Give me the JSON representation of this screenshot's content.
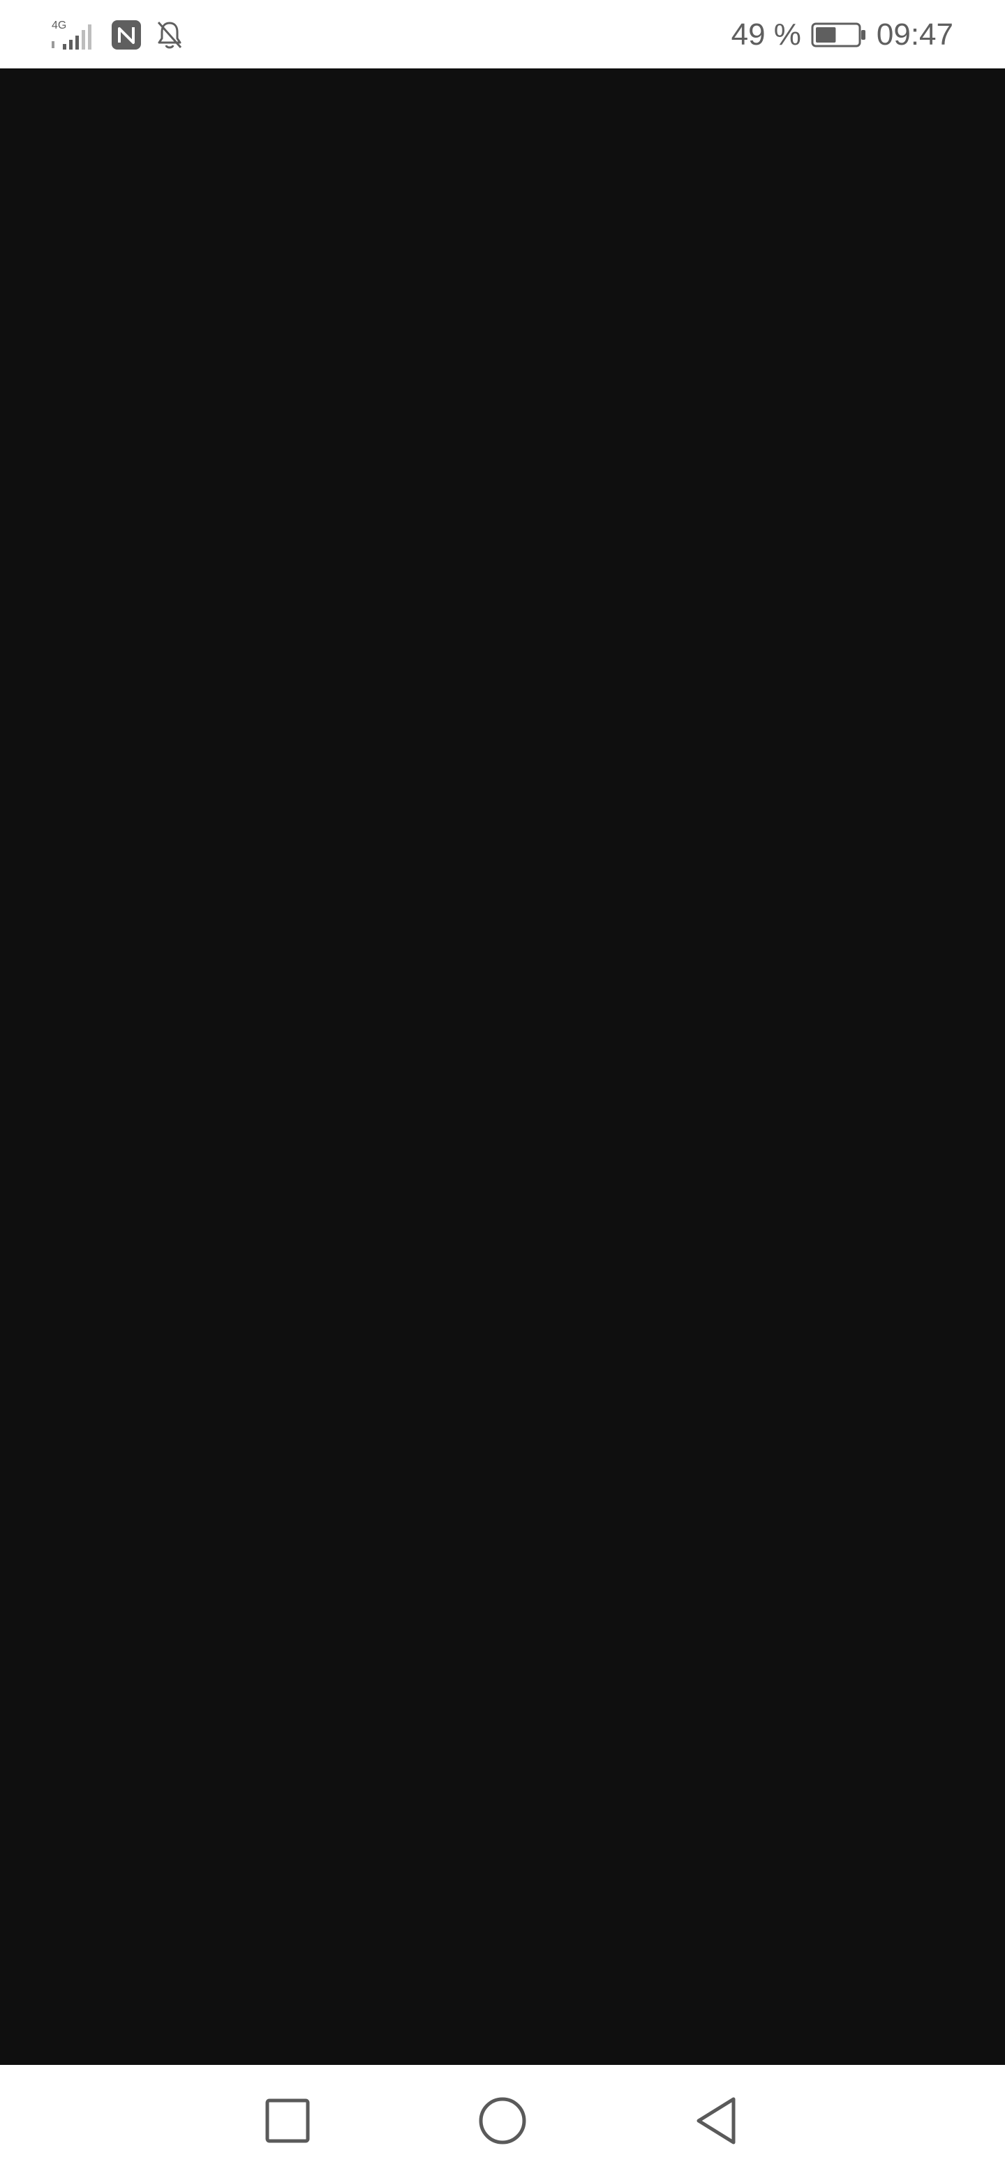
{
  "status_bar": {
    "network_type": "4G",
    "battery_percent_label": "49 %",
    "battery_level": 0.49,
    "time": "09:47",
    "icons": [
      "signal-icon",
      "nfc-icon",
      "bell-off-icon",
      "battery-icon"
    ]
  },
  "content": {
    "background_color": "#0f0f0f"
  },
  "navigation_bar": {
    "buttons": [
      "recent-apps-icon",
      "home-icon",
      "back-icon"
    ]
  },
  "colors": {
    "status_icon": "#5f5f5f",
    "nav_icon": "#5a5a5a",
    "bar_background": "#ffffff"
  }
}
